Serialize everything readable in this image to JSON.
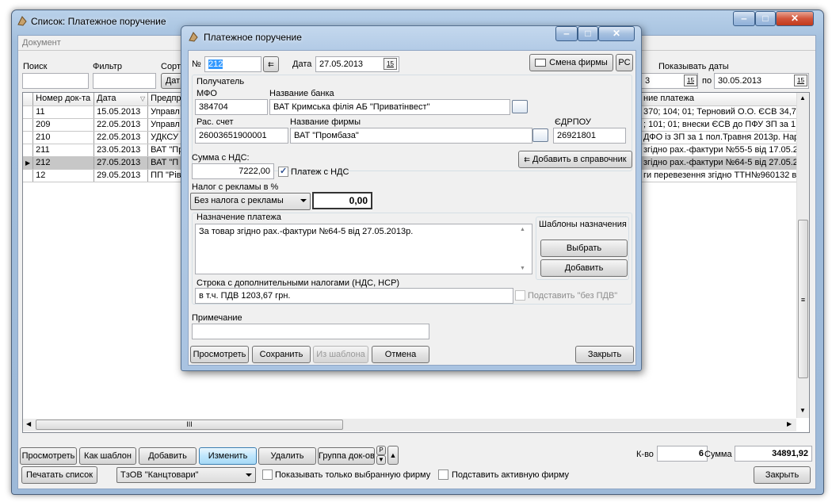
{
  "main_window": {
    "title": "Список: Платежное поручение",
    "menu_document": "Документ",
    "search_label": "Поиск",
    "filter_label": "Фильтр",
    "sort_label": "Сорт",
    "sort_btn_stub": "Дат",
    "date_from_stub": "3",
    "show_dates_label": "Показывать даты",
    "date_to_prefix": "по",
    "date_to": "30.05.2013",
    "columns": [
      "Номер док-та",
      "Дата",
      "Предпр",
      "ние платежа"
    ],
    "rows": [
      {
        "num": "11",
        "date": "15.05.2013",
        "firm": "Управл",
        "purpose": "370; 104; 01; Терновий О.О. ЄСВ 34,7%"
      },
      {
        "num": "209",
        "date": "22.05.2013",
        "firm": "Управл",
        "purpose": "; 101; 01; внески ЄСВ до ПФУ ЗП за 1"
      },
      {
        "num": "210",
        "date": "22.05.2013",
        "firm": "УДКСУ",
        "purpose": "ДФО із ЗП за 1 пол.Травня 2013р. Нар"
      },
      {
        "num": "211",
        "date": "23.05.2013",
        "firm": "ВАТ \"Пр",
        "purpose": "згідно рах.-фактури №55-5 від 17.05.20"
      },
      {
        "num": "212",
        "date": "27.05.2013",
        "firm": "ВАТ \"П",
        "purpose": "згідно рах.-фактури №64-5 від 27.05.20"
      },
      {
        "num": "12",
        "date": "29.05.2013",
        "firm": "ПП \"Рів",
        "purpose": "ги перевезення згідно ТТН№960132 в"
      }
    ],
    "selected_row_index": 4,
    "scroll_h_mark": "III",
    "scroll_v_mark": "≡",
    "buttons": {
      "view": "Просмотреть",
      "as_template": "Как шаблон",
      "add": "Добавить",
      "edit": "Изменить",
      "delete": "Удалить",
      "group": "Группа док-ов",
      "print": "Печатать список",
      "close": "Закрыть"
    },
    "firm_select": "ТзОВ \"Канцтовари\"",
    "show_only_selected_firm": "Показывать только выбранную фирму",
    "substitute_active_firm": "Подставить активную фирму",
    "count_label": "К-во",
    "count_value": "6",
    "sum_label": "Сумма",
    "sum_value": "34891,92"
  },
  "dialog": {
    "title": "Платежное поручение",
    "num_label": "№",
    "num_value": "212",
    "date_label": "Дата",
    "date_value": "27.05.2013",
    "change_firm_btn": "Смена фирмы",
    "rs_btn": "РС",
    "recipient_label": "Получатель",
    "mfo_label": "МФО",
    "mfo_value": "384704",
    "bank_label": "Название банка",
    "bank_value": "ВАТ Кримська філія АБ \"Приватінвест\"",
    "account_label": "Рас. счет",
    "account_value": "26003651900001",
    "firm_label": "Название фирмы",
    "firm_value": "ВАТ \"Промбаза\"",
    "edrpou_label": "ЄДРПОУ",
    "edrpou_value": "26921801",
    "sum_vat_label": "Сумма с НДС:",
    "sum_vat_value": "7222,00",
    "vat_payment_label": "Платеж с НДС",
    "vat_payment_checked": true,
    "add_to_directory_btn": "Добавить в справочник",
    "ad_tax_label": "Налог с рекламы в %",
    "ad_tax_select": "Без налога с рекламы",
    "ad_tax_value": "0,00",
    "purpose_label": "Назначение платежа",
    "purpose_value": "За товар згідно рах.-фактури №64-5 від 27.05.2013р.",
    "templates_label": "Шаблоны назначения",
    "choose_btn": "Выбрать",
    "add_btn": "Добавить",
    "extra_tax_label": "Строка с дополнительными налогами (НДС, НСР)",
    "extra_tax_value": "в т.ч. ПДВ 1203,67 грн.",
    "no_vat_label": "Подставить \"без ПДВ\"",
    "note_label": "Примечание",
    "note_value": "",
    "view_btn": "Просмотреть",
    "save_btn": "Сохранить",
    "from_template_btn": "Из шаблона",
    "cancel_btn": "Отмена",
    "close_btn": "Закрыть"
  },
  "colors": {
    "accent_selection": "#3399ff",
    "window_frame": "#a9c3e1",
    "row_selected": "#c7c7c7"
  }
}
